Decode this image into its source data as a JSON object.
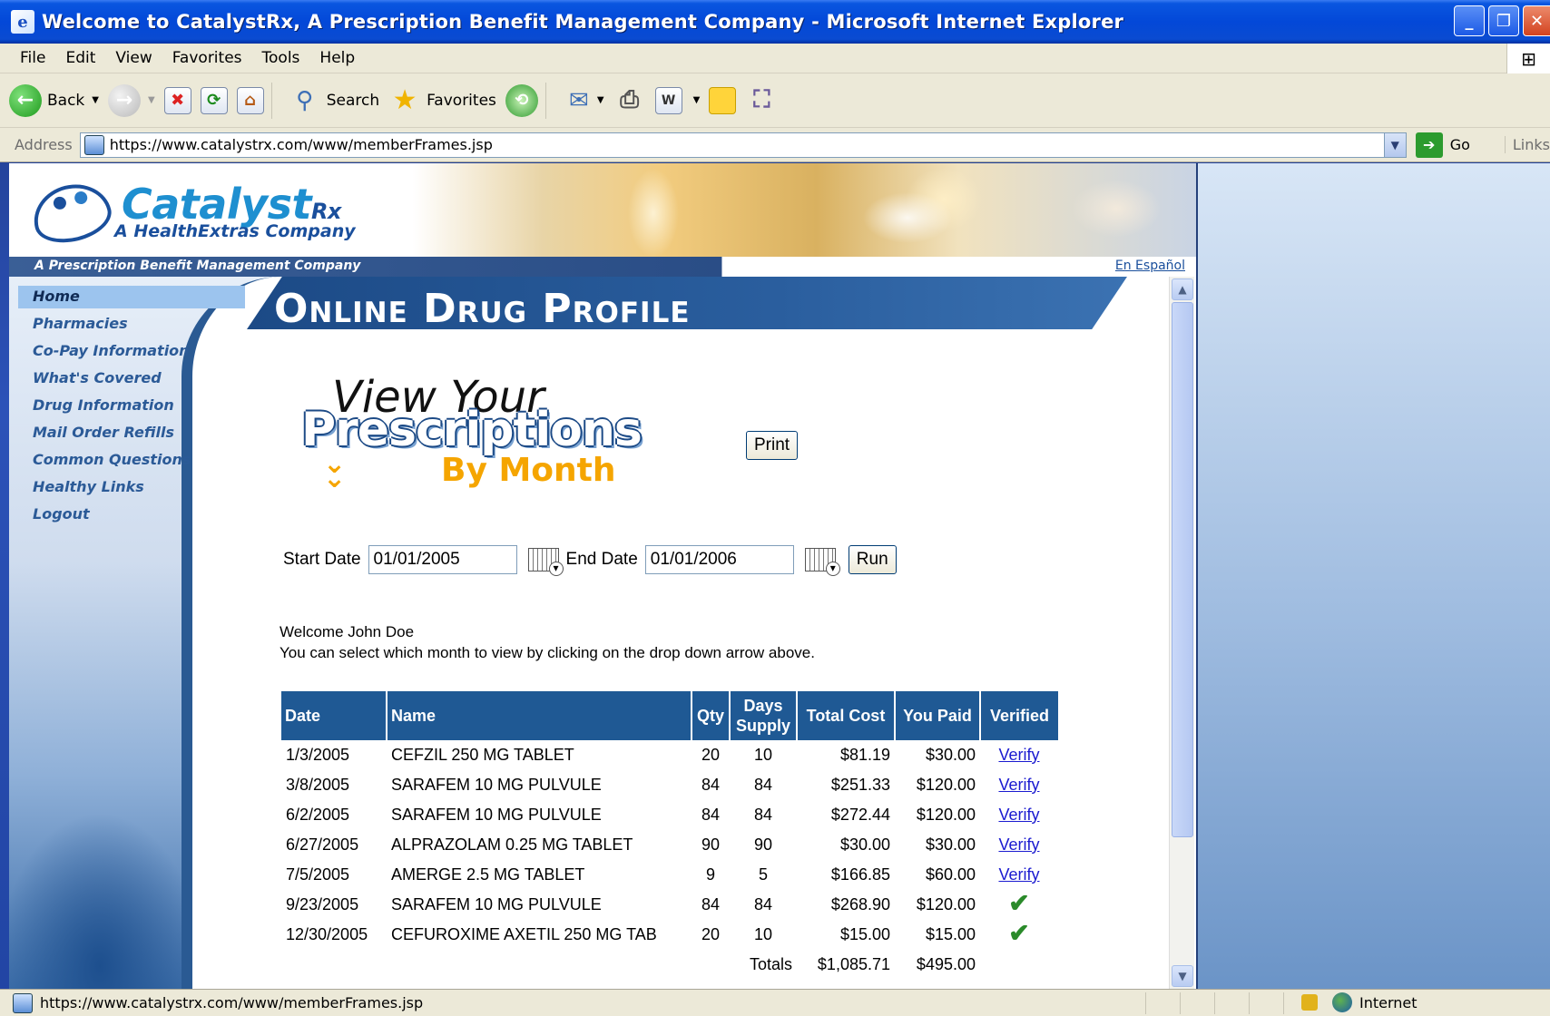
{
  "window": {
    "title": "Welcome to CatalystRx, A Prescription Benefit Management Company - Microsoft Internet Explorer",
    "icon": "ie-page-icon"
  },
  "menu": [
    "File",
    "Edit",
    "View",
    "Favorites",
    "Tools",
    "Help"
  ],
  "toolbar": {
    "back_label": "Back",
    "search_label": "Search",
    "favorites_label": "Favorites"
  },
  "address": {
    "label": "Address",
    "url": "https://www.catalystrx.com/www/memberFrames.jsp",
    "go_label": "Go",
    "links_label": "Links"
  },
  "site": {
    "logo_name": "Catalyst",
    "logo_rx": "Rx",
    "logo_tagline": "A HealthExtras Company",
    "subtitle": "A Prescription Benefit Management Company",
    "spanish_link": "En Español",
    "page_heading": "Online Drug Profile"
  },
  "nav": {
    "items": [
      {
        "label": "Home",
        "active": true
      },
      {
        "label": "Pharmacies"
      },
      {
        "label": "Co-Pay Information"
      },
      {
        "label": "What's Covered"
      },
      {
        "label": "Drug Information"
      },
      {
        "label": "Mail Order Refills"
      },
      {
        "label": "Common Questions"
      },
      {
        "label": "Healthy Links"
      },
      {
        "label": "Logout"
      }
    ]
  },
  "title_graphic": {
    "line1": "View Your",
    "line2": "Prescriptions",
    "line3": "By Month"
  },
  "print_label": "Print",
  "filters": {
    "start_label": "Start Date",
    "start_value": "01/01/2005",
    "end_label": "End Date",
    "end_value": "01/01/2006",
    "run_label": "Run"
  },
  "welcome": {
    "line1": "Welcome John Doe",
    "line2": "You can select which month to view by clicking on the drop down arrow above."
  },
  "table": {
    "headers": {
      "date": "Date",
      "name": "Name",
      "qty": "Qty",
      "days1": "Days",
      "days2": "Supply",
      "total": "Total Cost",
      "paid": "You Paid",
      "verified": "Verified"
    },
    "rows": [
      {
        "date": "1/3/2005",
        "name": "CEFZIL 250 MG TABLET",
        "qty": "20",
        "days": "10",
        "total": "$81.19",
        "paid": "$30.00",
        "verified": "Verify"
      },
      {
        "date": "3/8/2005",
        "name": "SARAFEM 10 MG PULVULE",
        "qty": "84",
        "days": "84",
        "total": "$251.33",
        "paid": "$120.00",
        "verified": "Verify"
      },
      {
        "date": "6/2/2005",
        "name": "SARAFEM 10 MG PULVULE",
        "qty": "84",
        "days": "84",
        "total": "$272.44",
        "paid": "$120.00",
        "verified": "Verify"
      },
      {
        "date": "6/27/2005",
        "name": "ALPRAZOLAM 0.25 MG TABLET",
        "qty": "90",
        "days": "90",
        "total": "$30.00",
        "paid": "$30.00",
        "verified": "Verify"
      },
      {
        "date": "7/5/2005",
        "name": "AMERGE 2.5 MG TABLET",
        "qty": "9",
        "days": "5",
        "total": "$166.85",
        "paid": "$60.00",
        "verified": "Verify"
      },
      {
        "date": "9/23/2005",
        "name": "SARAFEM 10 MG PULVULE",
        "qty": "84",
        "days": "84",
        "total": "$268.90",
        "paid": "$120.00",
        "verified": "check"
      },
      {
        "date": "12/30/2005",
        "name": "CEFUROXIME AXETIL 250 MG TAB",
        "qty": "20",
        "days": "10",
        "total": "$15.00",
        "paid": "$15.00",
        "verified": "check"
      }
    ],
    "totals_label": "Totals",
    "totals_cost": "$1,085.71",
    "totals_paid": "$495.00"
  },
  "status": {
    "url": "https://www.catalystrx.com/www/memberFrames.jsp",
    "zone": "Internet"
  }
}
